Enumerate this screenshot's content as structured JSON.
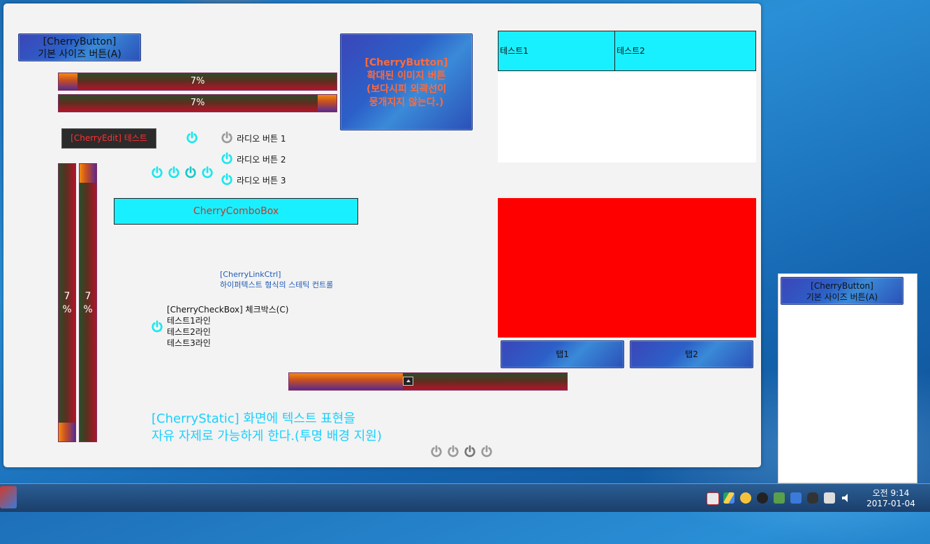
{
  "window": {
    "top_button": "[CherryButton]\n기본 사이즈 버튼(A)",
    "progress_h1": "7%",
    "progress_h2": "7%",
    "progress_value": 0.07,
    "image_button": "[CherryButton]\n확대된 이미지 버튼\n(보다시피 외곽선이\n뭉개지지 않는다.)",
    "edit_text": "[CherryEdit] 테스트",
    "radios": [
      "라디오 버튼 1",
      "라디오 버튼 2",
      "라디오 버튼 3"
    ],
    "vprogress1": "7\n%",
    "vprogress2": "7\n%",
    "combo": "CherryComboBox",
    "link_text": "[CherryLinkCtrl]\n하이퍼텍스트 형식의 스테틱 컨트롤",
    "checkbox_text": "[CherryCheckBox] 체크박스(C)\n테스트1라인\n테스트2라인\n테스트3라인",
    "static_text": "[CherryStatic] 화면에 텍스트 표현을\n자유 자제로 가능하게 한다.(투명 배경 지원)",
    "list_headers": [
      "테스트1",
      "테스트2"
    ],
    "tabs": [
      "탭1",
      "탭2"
    ],
    "slider_value": 0.41
  },
  "side_window": {
    "button": "[CherryButton]\n기본 사이즈 버튼(A)"
  },
  "taskbar": {
    "time": "오전 9:14",
    "date": "2017-01-04"
  },
  "colors": {
    "cyan": "#19f0ff",
    "red_panel": "#ff0000",
    "link": "#1e5ab8",
    "static": "#19d0ff"
  }
}
